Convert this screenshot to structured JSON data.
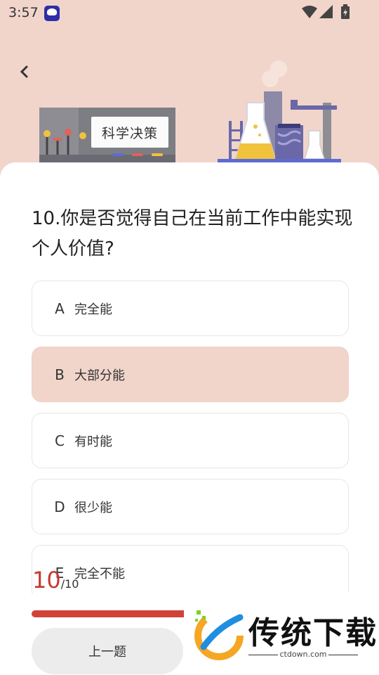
{
  "status_bar": {
    "time": "3:57"
  },
  "hero": {
    "board_label": "科学决策"
  },
  "question": {
    "text": "10.你是否觉得自己在当前工作中能实现个人价值?"
  },
  "options": [
    {
      "letter": "A",
      "text": "完全能",
      "selected": false
    },
    {
      "letter": "B",
      "text": "大部分能",
      "selected": true
    },
    {
      "letter": "C",
      "text": "有时能",
      "selected": false
    },
    {
      "letter": "D",
      "text": "很少能",
      "selected": false
    },
    {
      "letter": "E",
      "text": "完全不能",
      "selected": false
    }
  ],
  "progress": {
    "current": "10",
    "total": "/10",
    "fraction": 1.0
  },
  "buttons": {
    "prev": "上一题"
  },
  "watermark": {
    "title": "传统下载",
    "url": "ctdown.com"
  },
  "colors": {
    "accent": "#d14338",
    "selected_bg": "#f1d5cb",
    "page_bg": "#f1d5cb"
  }
}
